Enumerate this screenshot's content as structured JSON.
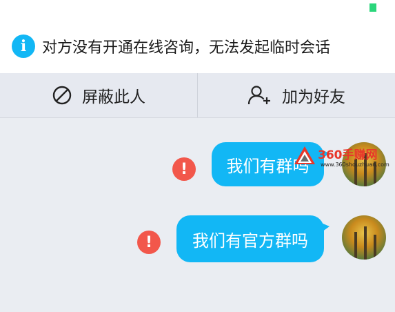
{
  "notice": {
    "text": "对方没有开通在线咨询，无法发起临时会话",
    "icon": "info-icon"
  },
  "actions": [
    {
      "label": "屏蔽此人",
      "icon": "block-icon"
    },
    {
      "label": "加为好友",
      "icon": "add-friend-icon"
    }
  ],
  "messages": [
    {
      "text": "我们有群吗",
      "status": "send-failed"
    },
    {
      "text": "我们有官方群吗",
      "status": "send-failed"
    }
  ],
  "watermark": {
    "title": "360手赚网",
    "url": "www.360shouzhuan.com"
  },
  "colors": {
    "accent": "#12b7f5",
    "error": "#f2574b",
    "status": "#2bd67b"
  }
}
